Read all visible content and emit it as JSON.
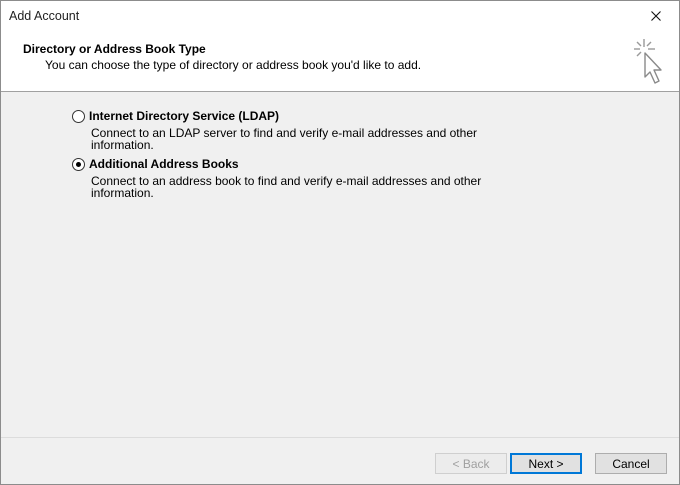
{
  "window": {
    "title": "Add Account",
    "close_icon": "close-icon"
  },
  "header": {
    "title": "Directory or Address Book Type",
    "subtitle": "You can choose the type of directory or address book you'd like to add.",
    "art_icon": "sparkle-cursor-icon"
  },
  "options": [
    {
      "label": "Internet Directory Service (LDAP)",
      "description": "Connect to an LDAP server to find and verify e-mail addresses and other information.",
      "selected": false
    },
    {
      "label": "Additional Address Books",
      "description": "Connect to an address book to find and verify e-mail addresses and other information.",
      "selected": true
    }
  ],
  "footer": {
    "back_label": "< Back",
    "next_label": "Next >",
    "cancel_label": "Cancel"
  },
  "colors": {
    "default_button_border": "#0078d7",
    "dialog_background": "#f0f0f0",
    "header_background": "#ffffff"
  }
}
